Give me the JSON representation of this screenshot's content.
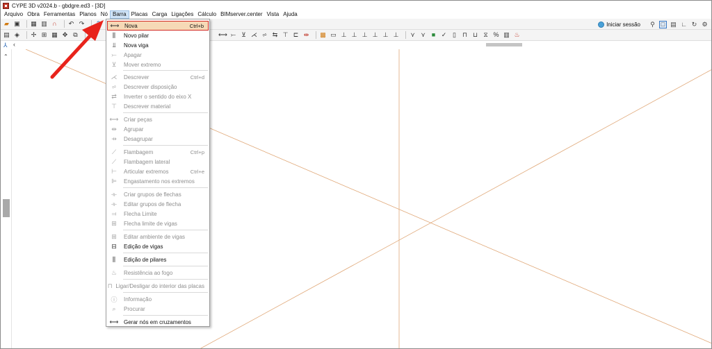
{
  "window": {
    "title": "CYPE 3D v2024.b - gbdgre.ed3 - [3D]"
  },
  "menubar": {
    "items": [
      "Arquivo",
      "Obra",
      "Ferramentas",
      "Planos",
      "Nó",
      "Barra",
      "Placas",
      "Carga",
      "Ligações",
      "Cálculo",
      "BIMserver.center",
      "Vista",
      "Ajuda"
    ],
    "active": "Barra"
  },
  "toolbar": {
    "session_label": "Iniciar sessão"
  },
  "dropdown": {
    "items": [
      {
        "label": "Nova",
        "shortcut": "Ctrl+b",
        "icon": "new-bar-icon",
        "enabled": true,
        "highlight": true
      },
      {
        "label": "Novo pilar",
        "shortcut": "",
        "icon": "new-column-icon",
        "enabled": true
      },
      {
        "label": "Nova viga",
        "shortcut": "",
        "icon": "new-beam-icon",
        "enabled": true
      },
      {
        "label": "Apagar",
        "shortcut": "",
        "icon": "delete-icon",
        "enabled": false
      },
      {
        "label": "Mover extremo",
        "shortcut": "",
        "icon": "move-end-icon",
        "enabled": false
      },
      {
        "label": "Descrever",
        "shortcut": "Ctrl+d",
        "icon": "describe-icon",
        "enabled": false
      },
      {
        "label": "Descrever disposição",
        "shortcut": "",
        "icon": "describe-layout-icon",
        "enabled": false
      },
      {
        "label": "Inverter o sentido do eixo X",
        "shortcut": "",
        "icon": "invert-axis-icon",
        "enabled": false
      },
      {
        "label": "Descrever material",
        "shortcut": "",
        "icon": "describe-material-icon",
        "enabled": false
      },
      {
        "label": "Criar peças",
        "shortcut": "",
        "icon": "create-pieces-icon",
        "enabled": false
      },
      {
        "label": "Agrupar",
        "shortcut": "",
        "icon": "group-icon",
        "enabled": false
      },
      {
        "label": "Desagrupar",
        "shortcut": "",
        "icon": "ungroup-icon",
        "enabled": false
      },
      {
        "label": "Flambagem",
        "shortcut": "Ctrl+p",
        "icon": "buckling-icon",
        "enabled": false
      },
      {
        "label": "Flambagem lateral",
        "shortcut": "",
        "icon": "lateral-buckling-icon",
        "enabled": false
      },
      {
        "label": "Articular extremos",
        "shortcut": "Ctrl+e",
        "icon": "articulate-ends-icon",
        "enabled": false
      },
      {
        "label": "Engastamento nos extremos",
        "shortcut": "",
        "icon": "fixed-ends-icon",
        "enabled": false
      },
      {
        "label": "Criar grupos de flechas",
        "shortcut": "",
        "icon": "create-deflection-groups-icon",
        "enabled": false
      },
      {
        "label": "Editar grupos de flecha",
        "shortcut": "",
        "icon": "edit-deflection-groups-icon",
        "enabled": false
      },
      {
        "label": "Flecha Limite",
        "shortcut": "",
        "icon": "deflection-limit-icon",
        "enabled": false
      },
      {
        "label": "Flecha limite de vigas",
        "shortcut": "",
        "icon": "beam-deflection-limit-icon",
        "enabled": false
      },
      {
        "label": "Editar ambiente de vigas",
        "shortcut": "",
        "icon": "beam-environment-icon",
        "enabled": false
      },
      {
        "label": "Edição de vigas",
        "shortcut": "",
        "icon": "beam-edit-icon",
        "enabled": true
      },
      {
        "label": "Edição de pilares",
        "shortcut": "",
        "icon": "column-edit-icon",
        "enabled": true
      },
      {
        "label": "Resistência ao fogo",
        "shortcut": "",
        "icon": "fire-resistance-icon",
        "enabled": false
      },
      {
        "label": "Ligar/Desligar do interior das placas",
        "shortcut": "",
        "icon": "plate-link-icon",
        "enabled": false
      },
      {
        "label": "Informação",
        "shortcut": "",
        "icon": "info-icon",
        "enabled": false
      },
      {
        "label": "Procurar",
        "shortcut": "",
        "icon": "find-icon",
        "enabled": false
      },
      {
        "label": "Gerar nós em cruzamentos",
        "shortcut": "",
        "icon": "generate-nodes-icon",
        "enabled": true
      }
    ]
  },
  "colors": {
    "guide_lines": "#e0a878",
    "highlight_border": "#d2261f",
    "highlight_fill": "#f6d9b6",
    "arrow": "#e8231b"
  }
}
